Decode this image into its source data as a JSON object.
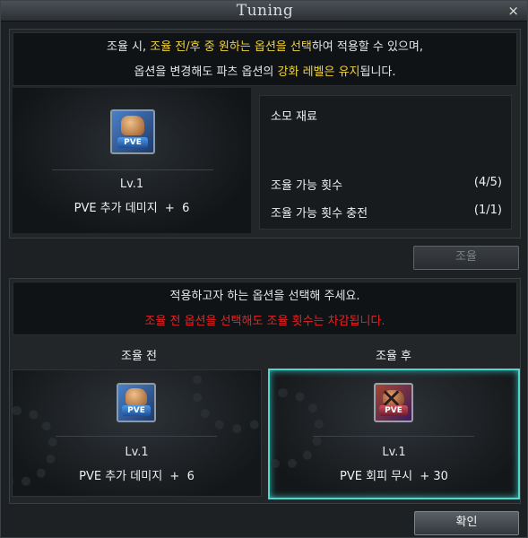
{
  "window": {
    "title": "Tuning",
    "close_glyph": "×"
  },
  "top_notice": {
    "line1": [
      {
        "text": "조율 시, ",
        "style": "normal"
      },
      {
        "text": "조율 전/후 중 원하는 옵션을 선택",
        "style": "highlight"
      },
      {
        "text": "하여 적용할 수 있으며,",
        "style": "normal"
      }
    ],
    "line2": [
      {
        "text": "옵션을 변경해도 파츠 옵션의 ",
        "style": "normal"
      },
      {
        "text": "강화 레벨은 유지",
        "style": "highlight"
      },
      {
        "text": "됩니다.",
        "style": "normal"
      }
    ]
  },
  "part_card": {
    "icon": "pve-fist-icon",
    "level": "Lv.1",
    "option": "PVE 추가 데미지  +  6"
  },
  "materials": {
    "title": "소모 재료",
    "rows": [
      {
        "label": "조율 가능 횟수",
        "value": "(4/5)"
      },
      {
        "label": "조율 가능 횟수 충전",
        "value": "(1/1)"
      }
    ]
  },
  "tune_button": {
    "label": "조율",
    "enabled": false
  },
  "bottom_notice": {
    "line1": "적용하고자 하는 옵션을 선택해 주세요.",
    "line2": "조율 전 옵션을 선택해도 조율 횟수는 차감됩니다."
  },
  "before": {
    "title": "조율 전",
    "icon": "pve-fist-icon",
    "level": "Lv.1",
    "option": "PVE 추가 데미지  +  6",
    "selected": false
  },
  "after": {
    "title": "조율 후",
    "icon": "pve-no-dodge-icon",
    "level": "Lv.1",
    "option": "PVE 회피 무시  + 30",
    "selected": true
  },
  "confirm_button": {
    "label": "확인"
  },
  "colors": {
    "highlight": "#f0d23a",
    "warning": "#e82222",
    "selection": "#4fd6cf"
  }
}
